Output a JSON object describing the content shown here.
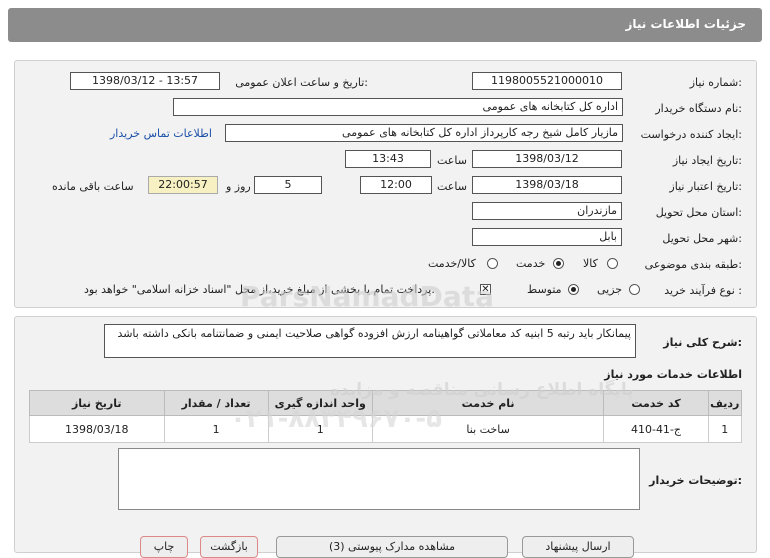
{
  "header": {
    "title": "جزئیات اطلاعات نیاز"
  },
  "form": {
    "need_number_label": "شماره نیاز:",
    "need_number": "1198005521000010",
    "announce_label": "تاریخ و ساعت اعلان عمومی:",
    "announce_value": "1398/03/12 - 13:57",
    "buyer_org_label": "نام دستگاه خریدار:",
    "buyer_org": "اداره کل کتابخانه های عمومی",
    "creator_label": "ایجاد کننده درخواست:",
    "creator": "مازیار کامل شیخ رجه کارپرداز اداره کل کتابخانه های عمومی",
    "contact_link": "اطلاعات تماس خریدار",
    "create_date_label": "تاریخ ایجاد نیاز:",
    "create_date": "1398/03/12",
    "create_time_label": "ساعت",
    "create_time": "13:43",
    "validity_label": "تاریخ اعتبار نیاز:",
    "validity_date": "1398/03/18",
    "validity_time_label": "ساعت",
    "validity_time": "12:00",
    "days": "5",
    "days_label": "روز و",
    "remaining": "22:00:57",
    "remaining_label": "ساعت باقی مانده",
    "province_label": "استان محل تحویل:",
    "province": "مازندران",
    "city_label": "شهر محل تحویل:",
    "city": "بابل",
    "category_label": "طبقه بندی موضوعی:",
    "category_options": [
      "کالا",
      "خدمت",
      "کالا/خدمت"
    ],
    "category_selected": "خدمت",
    "process_label": "نوع فرآیند خرید :",
    "process_options": [
      "جزیی",
      "متوسط"
    ],
    "process_selected": "متوسط",
    "payment_note": "پرداخت تمام یا بخشی از مبلغ خرید،از محل \"اسناد خزانه اسلامی\" خواهد بود."
  },
  "description": {
    "label": "شرح کلی نیاز:",
    "text": "پیمانکار باید رتبه 5 ابنیه کد معاملاتی گواهینامه ارزش افزوده گواهی صلاحیت ایمنی و ضمانتنامه بانکی داشته باشد"
  },
  "services": {
    "title": "اطلاعات خدمات مورد نیاز",
    "columns": [
      "ردیف",
      "کد خدمت",
      "نام خدمت",
      "واحد اندازه گیری",
      "تعداد / مقدار",
      "تاریخ نیاز"
    ],
    "rows": [
      [
        "1",
        "ج-41-410",
        "ساخت بنا",
        "1",
        "1",
        "1398/03/18"
      ]
    ]
  },
  "buyer_notes": {
    "label": "توضیحات خریدار:",
    "value": ""
  },
  "watermark": {
    "line1": "ParsNamadData",
    "line2": "پایگاه اطلاع رسانی مناقصه و مزایده",
    "line3": "۰۲۱-۸۸۳۴۹۶۷۰-۵"
  },
  "bottom_buttons": [
    "چاپ",
    "بازگشت",
    "مشاهده مدارک پیوستی (3)",
    "ارسال پیشنهاد"
  ]
}
